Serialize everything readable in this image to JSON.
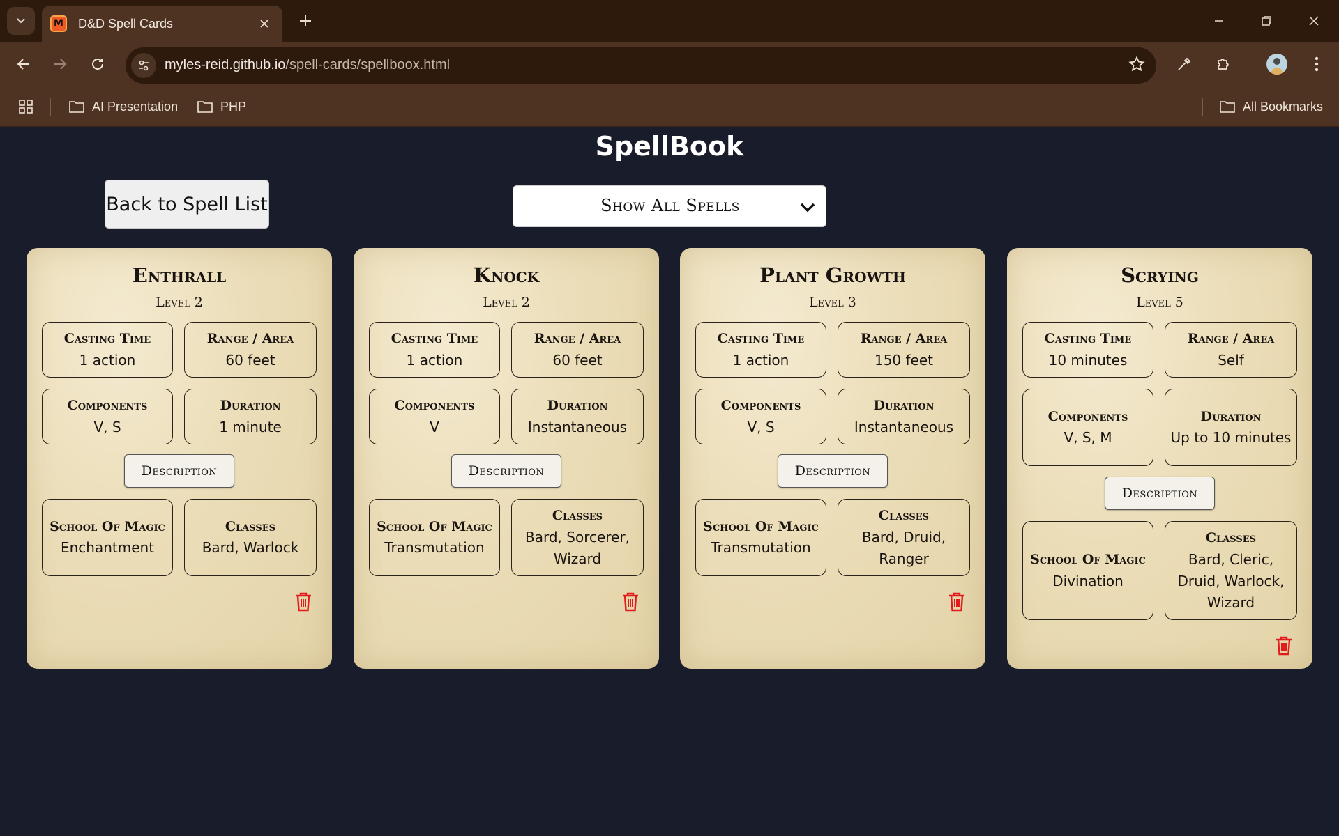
{
  "browser": {
    "tab_title": "D&D Spell Cards",
    "favicon_letter": "M",
    "url_host": "myles-reid.github.io",
    "url_path": "/spell-cards/spellboox.html",
    "bookmarks": [
      "AI Presentation",
      "PHP"
    ],
    "all_bookmarks": "All Bookmarks"
  },
  "page": {
    "title": "SpellBook",
    "back_button": "Back to Spell List",
    "filter_selected": "Show All Spells"
  },
  "labels": {
    "casting_time": "Casting Time",
    "range_area": "Range / Area",
    "components": "Components",
    "duration": "Duration",
    "description": "Description",
    "school": "School Of Magic",
    "classes": "Classes"
  },
  "cards": [
    {
      "name": "Enthrall",
      "level": "Level 2",
      "casting_time": "1 action",
      "range": "60 feet",
      "components": "V, S",
      "duration": "1 minute",
      "school": "Enchantment",
      "classes": "Bard, Warlock"
    },
    {
      "name": "Knock",
      "level": "Level 2",
      "casting_time": "1 action",
      "range": "60 feet",
      "components": "V",
      "duration": "Instantaneous",
      "school": "Transmutation",
      "classes": "Bard, Sorcerer, Wizard"
    },
    {
      "name": "Plant Growth",
      "level": "Level 3",
      "casting_time": "1 action",
      "range": "150 feet",
      "components": "V, S",
      "duration": "Instantaneous",
      "school": "Transmutation",
      "classes": "Bard, Druid, Ranger"
    },
    {
      "name": "Scrying",
      "level": "Level 5",
      "casting_time": "10 minutes",
      "range": "Self",
      "components": "V, S, M",
      "duration": "Up to 10 minutes",
      "school": "Divination",
      "classes": "Bard, Cleric, Druid, Warlock, Wizard"
    }
  ],
  "colors": {
    "page_bg": "#191c2a",
    "chrome_bg": "#4f3322",
    "tabbar_bg": "#2d1a0d",
    "card_parchment": "#ebddb8",
    "delete_red": "#e21b1b"
  }
}
